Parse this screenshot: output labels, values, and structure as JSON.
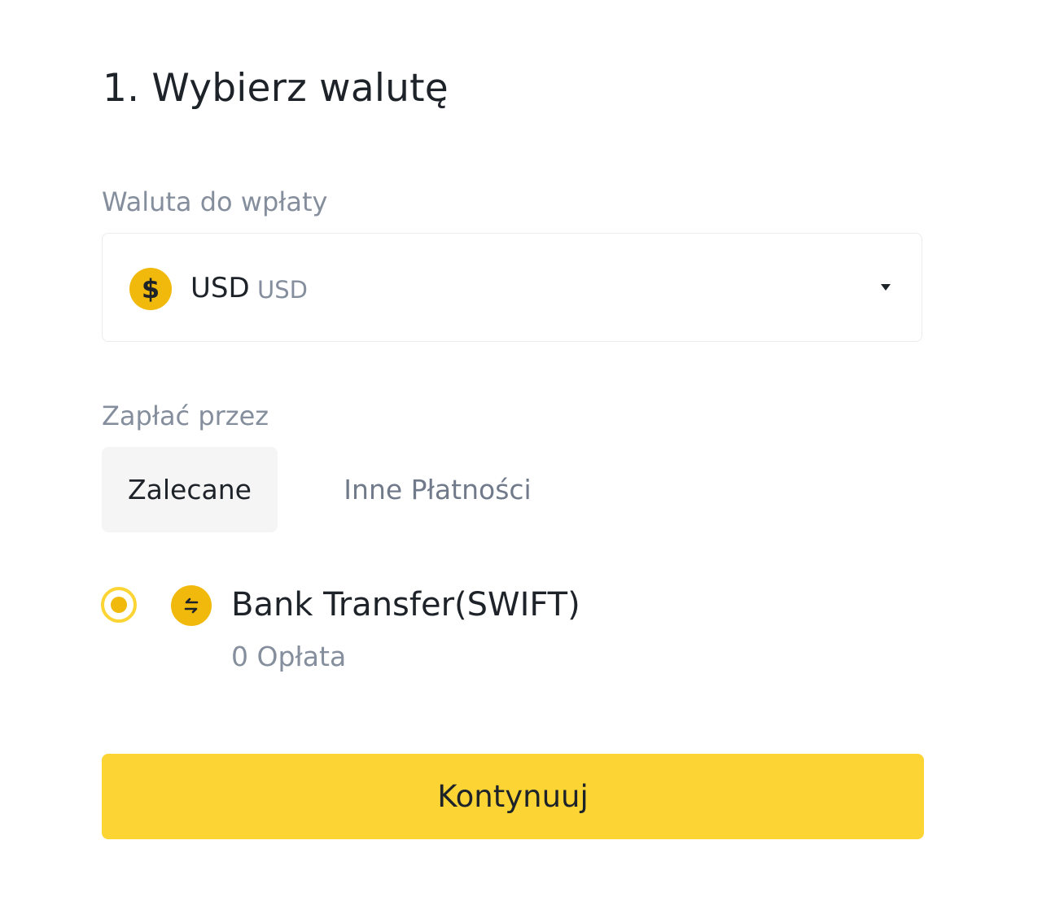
{
  "title": "1. Wybierz walutę",
  "currency_field": {
    "label": "Waluta do wpłaty",
    "selected_code": "USD",
    "selected_sub": "USD",
    "icon": "dollar-coin-icon",
    "icon_glyph": "$"
  },
  "pay_with": {
    "label": "Zapłać przez",
    "tabs": [
      {
        "label": "Zalecane",
        "active": true
      },
      {
        "label": "Inne Płatności",
        "active": false
      }
    ]
  },
  "method": {
    "name": "Bank Transfer(SWIFT)",
    "fee": "0 Opłata",
    "selected": true,
    "icon": "transfer-arrows-icon"
  },
  "continue_label": "Kontynuuj",
  "colors": {
    "accent": "#FCD535",
    "coin": "#F0B90B",
    "text_primary": "#1E2329",
    "text_secondary": "#848E9C"
  }
}
